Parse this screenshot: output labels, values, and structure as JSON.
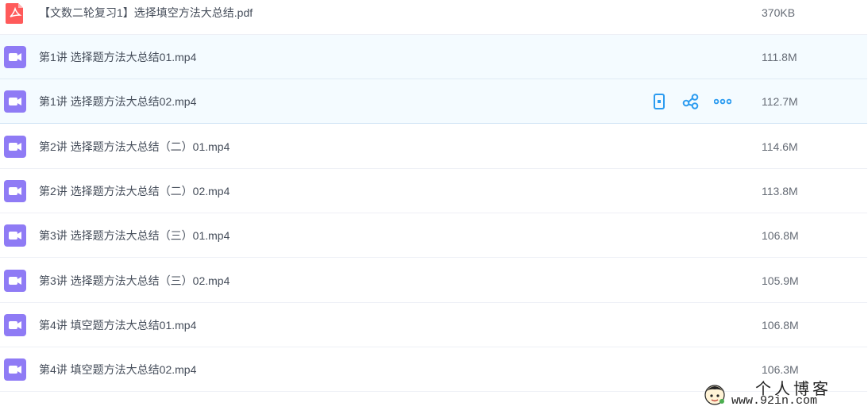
{
  "files": [
    {
      "name": "【文数二轮复习1】选择填空方法大总结.pdf",
      "size": "370KB",
      "type": "pdf",
      "icon": "pdf-icon"
    },
    {
      "name": "第1讲 选择题方法大总结01.mp4",
      "size": "111.8M",
      "type": "video",
      "icon": "video-icon"
    },
    {
      "name": "第1讲 选择题方法大总结02.mp4",
      "size": "112.7M",
      "type": "video",
      "icon": "video-icon"
    },
    {
      "name": "第2讲 选择题方法大总结（二）01.mp4",
      "size": "114.6M",
      "type": "video",
      "icon": "video-icon"
    },
    {
      "name": "第2讲 选择题方法大总结（二）02.mp4",
      "size": "113.8M",
      "type": "video",
      "icon": "video-icon"
    },
    {
      "name": "第3讲 选择题方法大总结（三）01.mp4",
      "size": "106.8M",
      "type": "video",
      "icon": "video-icon"
    },
    {
      "name": "第3讲 选择题方法大总结（三）02.mp4",
      "size": "105.9M",
      "type": "video",
      "icon": "video-icon"
    },
    {
      "name": "第4讲 填空题方法大总结01.mp4",
      "size": "106.8M",
      "type": "video",
      "icon": "video-icon"
    },
    {
      "name": "第4讲 填空题方法大总结02.mp4",
      "size": "106.3M",
      "type": "video",
      "icon": "video-icon"
    }
  ],
  "row_actions": [
    {
      "icon": "phone-icon"
    },
    {
      "icon": "share-icon"
    },
    {
      "icon": "more-icon"
    }
  ],
  "watermark": {
    "title": "个人博客",
    "url": "www.92in.com"
  },
  "colors": {
    "pdf": "#ff5a5a",
    "video": "#8f7bf5",
    "action": "#2b9bf0",
    "hover_bg": "#f4fbff"
  }
}
